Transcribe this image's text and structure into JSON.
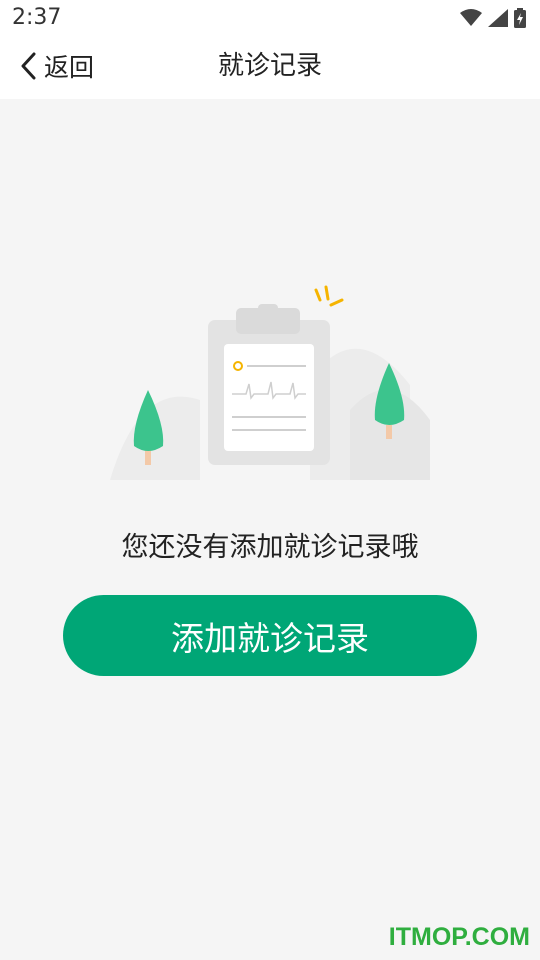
{
  "status_bar": {
    "time": "2:37",
    "icons": [
      "wifi-icon",
      "cellular-signal-icon",
      "battery-icon"
    ]
  },
  "nav": {
    "back_label": "返回",
    "back_icon": "chevron-left-icon",
    "title": "就诊记录"
  },
  "empty_state": {
    "illustration": "clipboard-ecg-illustration",
    "message": "您还没有添加就诊记录哦",
    "button_label": "添加就诊记录"
  },
  "watermark": {
    "text": "ITMOP.COM"
  },
  "colors": {
    "accent": "#00a676",
    "tree": "#3cc48d",
    "sparkle": "#f5b400",
    "watermark": "#2fae3f"
  }
}
